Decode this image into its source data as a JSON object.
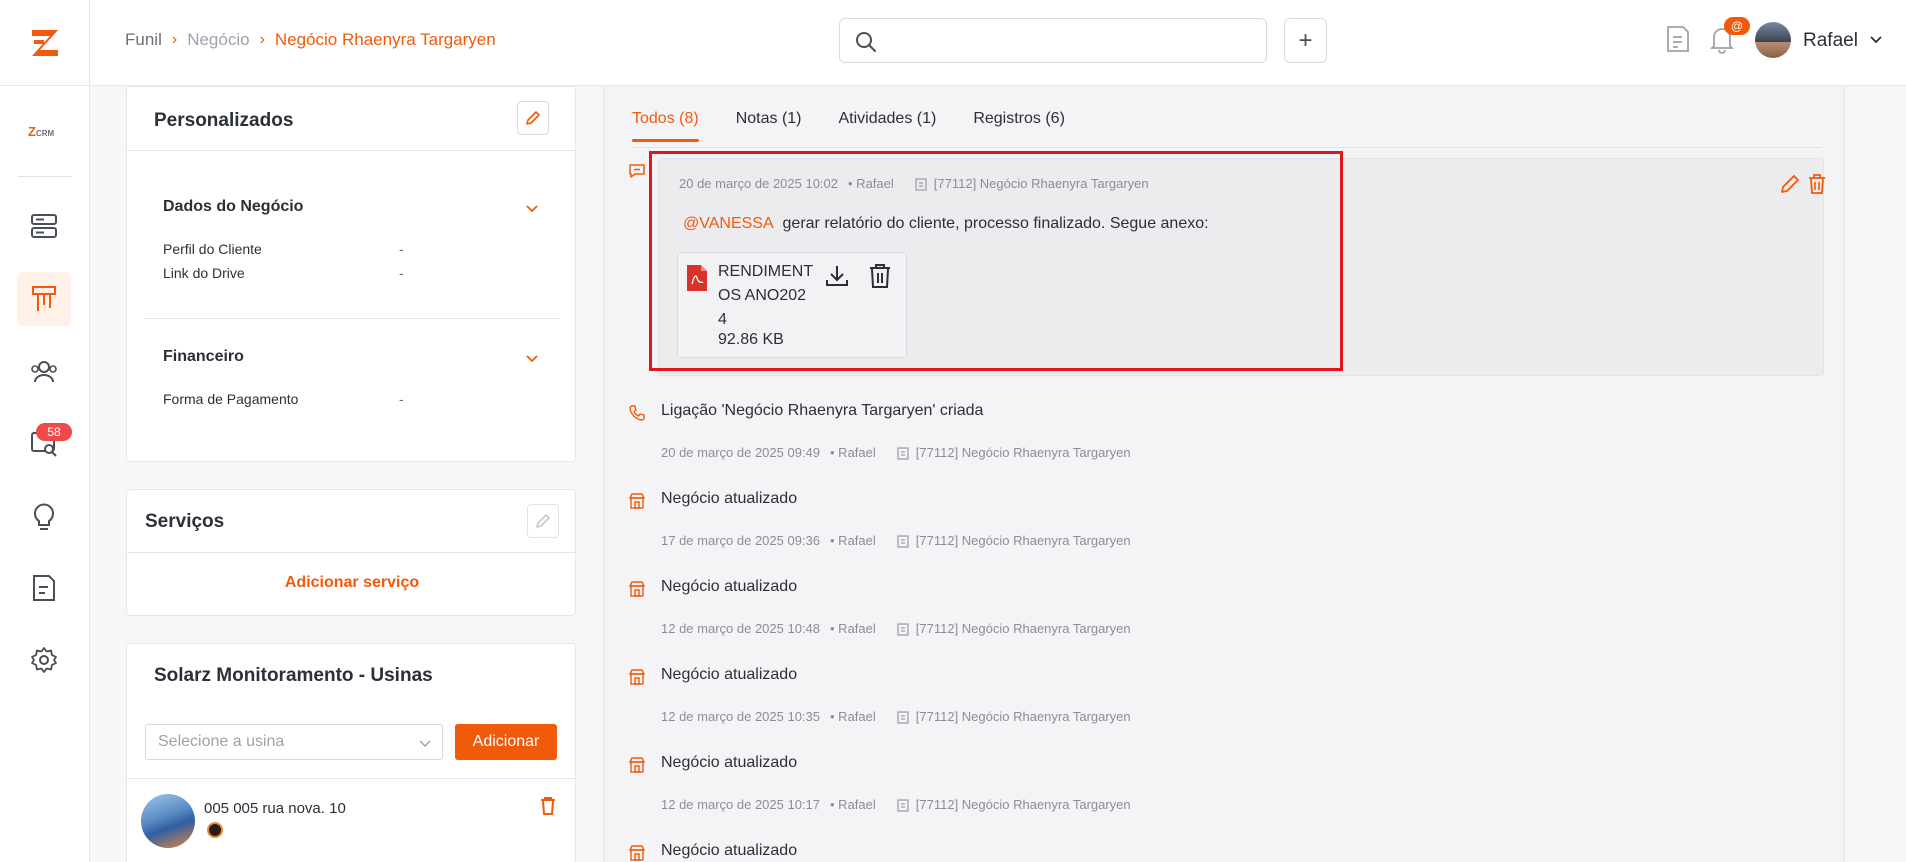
{
  "header": {
    "breadcrumb": [
      "Funil",
      "Negócio",
      "Negócio Rhaenyra Targaryen"
    ],
    "search_placeholder": "",
    "plus_label": "+",
    "notif_badge": "@",
    "user_name": "Rafael"
  },
  "sidebar": {
    "crm_label": "Z",
    "crm_small": "CRM",
    "badge": "58",
    "items": [
      {
        "icon": "server-stack-icon"
      },
      {
        "icon": "funnel-board-icon",
        "active": true
      },
      {
        "icon": "users-group-icon"
      },
      {
        "icon": "search-monitor-icon"
      },
      {
        "icon": "lightbulb-icon"
      },
      {
        "icon": "notes-icon"
      },
      {
        "icon": "gear-icon"
      }
    ]
  },
  "personalizados": {
    "title": "Personalizados",
    "sections": [
      {
        "title": "Dados do Negócio",
        "fields": [
          {
            "label": "Perfil do Cliente",
            "value": "-"
          },
          {
            "label": "Link do Drive",
            "value": "-"
          }
        ]
      },
      {
        "title": "Financeiro",
        "fields": [
          {
            "label": "Forma de Pagamento",
            "value": "-"
          }
        ]
      }
    ]
  },
  "servicos": {
    "title": "Serviços",
    "add_label": "Adicionar serviço"
  },
  "monitoramento": {
    "title": "Solarz Monitoramento - Usinas",
    "select_placeholder": "Selecione a usina",
    "add_button": "Adicionar",
    "usina_name": "005 005 rua nova. 10"
  },
  "tabs": [
    {
      "label": "Todos (8)",
      "active": true
    },
    {
      "label": "Notas (1)"
    },
    {
      "label": "Atividades (1)"
    },
    {
      "label": "Registros (6)"
    }
  ],
  "note": {
    "date": "20 de março de 2025 10:02",
    "author": "• Rafael",
    "deal": "[77112] Negócio Rhaenyra Targaryen",
    "mention": "@VANESSA",
    "text": "gerar relatório do cliente, processo finalizado. Segue anexo:",
    "attachment_name": "RENDIMENTOS ANO2024",
    "attachment_size": "92.86 KB"
  },
  "timeline": [
    {
      "icon": "phone-icon",
      "title": "Ligação 'Negócio Rhaenyra Targaryen' criada",
      "date": "20 de março de 2025 09:49",
      "author": "• Rafael",
      "deal": "[77112] Negócio Rhaenyra Targaryen"
    },
    {
      "icon": "building-icon",
      "title": "Negócio atualizado",
      "date": "17 de março de 2025 09:36",
      "author": "• Rafael",
      "deal": "[77112] Negócio Rhaenyra Targaryen"
    },
    {
      "icon": "building-icon",
      "title": "Negócio atualizado",
      "date": "12 de março de 2025 10:48",
      "author": "• Rafael",
      "deal": "[77112] Negócio Rhaenyra Targaryen"
    },
    {
      "icon": "building-icon",
      "title": "Negócio atualizado",
      "date": "12 de março de 2025 10:35",
      "author": "• Rafael",
      "deal": "[77112] Negócio Rhaenyra Targaryen"
    },
    {
      "icon": "building-icon",
      "title": "Negócio atualizado",
      "date": "12 de março de 2025 10:17",
      "author": "• Rafael",
      "deal": "[77112] Negócio Rhaenyra Targaryen"
    },
    {
      "icon": "building-icon",
      "title": "Negócio atualizado"
    }
  ],
  "colors": {
    "accent": "#f15a0a",
    "highlight": "#e0161c",
    "badge_red": "#ef4a4a"
  }
}
